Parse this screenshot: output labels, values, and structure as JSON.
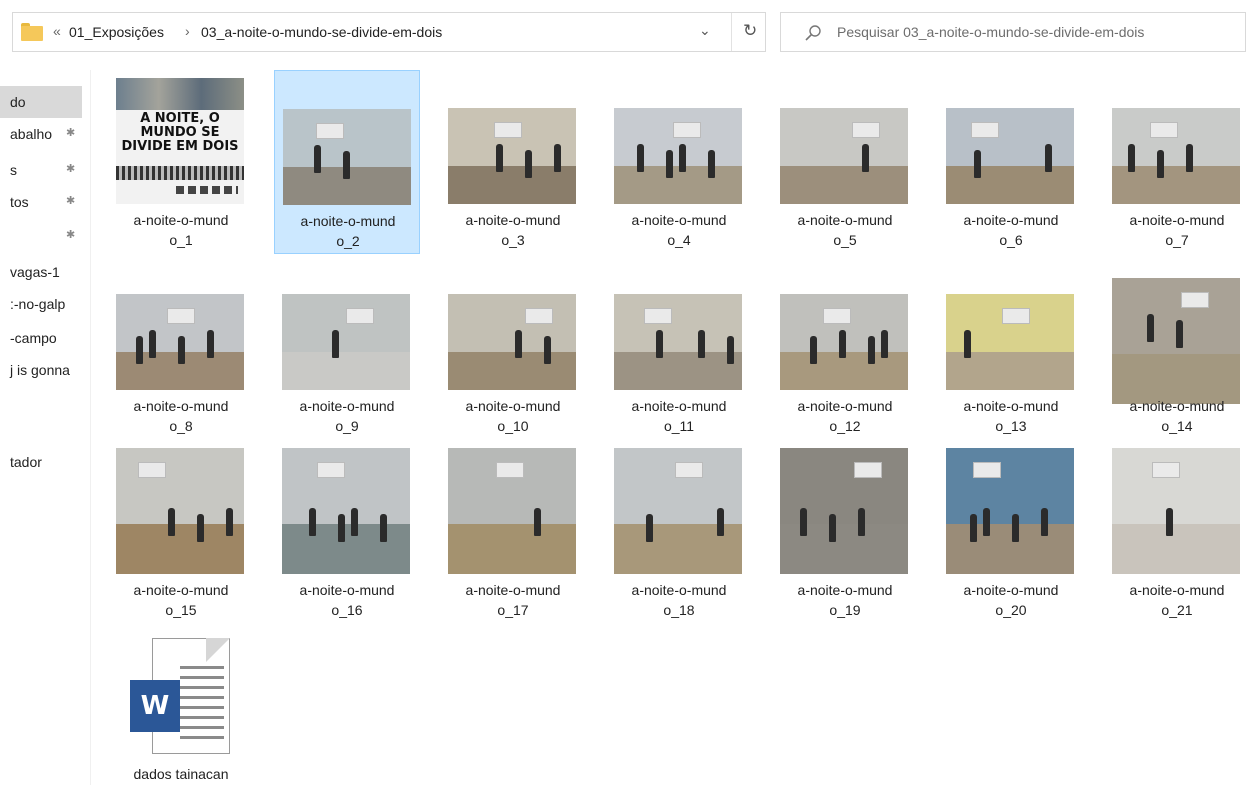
{
  "address": {
    "history_glyph": "«",
    "crumbs": [
      "01_Exposições",
      "03_a-noite-o-mundo-se-divide-em-dois"
    ],
    "separator": "›",
    "dropdown_glyph": "⌄",
    "refresh_glyph": "↻"
  },
  "search": {
    "placeholder": "Pesquisar 03_a-noite-o-mundo-se-divide-em-dois"
  },
  "nav": {
    "items": [
      {
        "label": "do",
        "pinned": false
      },
      {
        "label": "abalho",
        "pinned": true
      },
      {
        "label": "s",
        "pinned": true
      },
      {
        "label": "tos",
        "pinned": true
      },
      {
        "label": "",
        "pinned": true
      },
      {
        "label": "vagas-1",
        "pinned": false
      },
      {
        "label": ":-no-galp",
        "pinned": false
      },
      {
        "label": "-campo",
        "pinned": false
      },
      {
        "label": "j is gonna",
        "pinned": false
      },
      {
        "label": "tador",
        "pinned": false
      }
    ],
    "pin_glyph": "✱"
  },
  "files": [
    {
      "line1": "a-noite-o-mund",
      "line2": "o_1"
    },
    {
      "line1": "a-noite-o-mund",
      "line2": "o_2"
    },
    {
      "line1": "a-noite-o-mund",
      "line2": "o_3"
    },
    {
      "line1": "a-noite-o-mund",
      "line2": "o_4"
    },
    {
      "line1": "a-noite-o-mund",
      "line2": "o_5"
    },
    {
      "line1": "a-noite-o-mund",
      "line2": "o_6"
    },
    {
      "line1": "a-noite-o-mund",
      "line2": "o_7"
    },
    {
      "line1": "a-noite-o-mund",
      "line2": "o_8"
    },
    {
      "line1": "a-noite-o-mund",
      "line2": "o_9"
    },
    {
      "line1": "a-noite-o-mund",
      "line2": "o_10"
    },
    {
      "line1": "a-noite-o-mund",
      "line2": "o_11"
    },
    {
      "line1": "a-noite-o-mund",
      "line2": "o_12"
    },
    {
      "line1": "a-noite-o-mund",
      "line2": "o_13"
    },
    {
      "line1": "a-noite-o-mund",
      "line2": "o_14"
    },
    {
      "line1": "a-noite-o-mund",
      "line2": "o_15"
    },
    {
      "line1": "a-noite-o-mund",
      "line2": "o_16"
    },
    {
      "line1": "a-noite-o-mund",
      "line2": "o_17"
    },
    {
      "line1": "a-noite-o-mund",
      "line2": "o_18"
    },
    {
      "line1": "a-noite-o-mund",
      "line2": "o_19"
    },
    {
      "line1": "a-noite-o-mund",
      "line2": "o_20"
    },
    {
      "line1": "a-noite-o-mund",
      "line2": "o_21"
    }
  ],
  "selected_file_index": 1,
  "poster_title": "A NOITE, O MUNDO SE DIVIDE EM DOIS",
  "document": {
    "label": "dados tainacan",
    "badge": "W"
  },
  "colors": {
    "selection": "#cce8ff",
    "folder": "#f5c85a",
    "word": "#2b5797"
  },
  "icons": [
    "folder-icon",
    "refresh-icon",
    "search-icon",
    "pin-icon",
    "word-document-icon"
  ]
}
